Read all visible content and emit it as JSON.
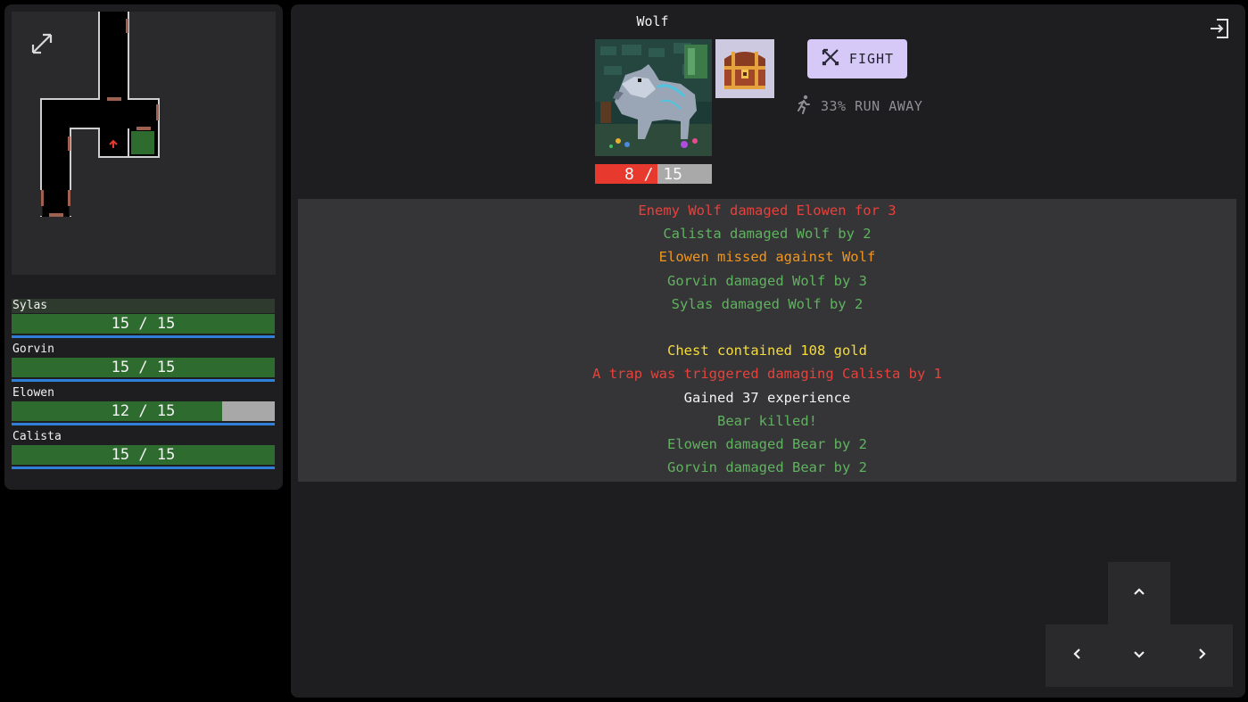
{
  "party": [
    {
      "name": "Sylas",
      "hp": 15,
      "max_hp": 15,
      "hp_text": "15 / 15"
    },
    {
      "name": "Gorvin",
      "hp": 15,
      "max_hp": 15,
      "hp_text": "15 / 15"
    },
    {
      "name": "Elowen",
      "hp": 12,
      "max_hp": 15,
      "hp_text": "12 / 15"
    },
    {
      "name": "Calista",
      "hp": 15,
      "max_hp": 15,
      "hp_text": "15 / 15"
    }
  ],
  "enemy": {
    "name": "Wolf",
    "hp": 8,
    "max_hp": 15,
    "hp_text": "8 / 15"
  },
  "actions": {
    "fight_label": "FIGHT",
    "run_label": "33% RUN AWAY"
  },
  "log": [
    {
      "text": "Enemy Wolf damaged Elowen for 3",
      "color": "#e8413a"
    },
    {
      "text": "Calista damaged Wolf by 2",
      "color": "#5fb35e"
    },
    {
      "text": "Elowen missed against Wolf",
      "color": "#f0961e"
    },
    {
      "text": "Gorvin damaged Wolf by 3",
      "color": "#5fb35e"
    },
    {
      "text": "Sylas damaged Wolf by 2",
      "color": "#5fb35e"
    },
    {
      "text": "",
      "color": "#ffffff"
    },
    {
      "text": "Chest contained 108 gold",
      "color": "#f5dc3c"
    },
    {
      "text": "A trap was triggered damaging Calista by 1",
      "color": "#e8413a"
    },
    {
      "text": "Gained 37 experience",
      "color": "#f2f2f2"
    },
    {
      "text": "Bear killed!",
      "color": "#5fb35e"
    },
    {
      "text": "Elowen damaged Bear by 2",
      "color": "#5fb35e"
    },
    {
      "text": "Gorvin damaged Bear by 2",
      "color": "#5fb35e"
    }
  ],
  "icons": {
    "expand": "expand-icon",
    "exit": "exit-icon",
    "fight": "crossed-swords-icon",
    "run": "running-person-icon",
    "player_marker": "arrow-up-icon",
    "dpad": [
      "chevron-up-icon",
      "chevron-left-icon",
      "chevron-down-icon",
      "chevron-right-icon"
    ]
  },
  "colors": {
    "hp_green": "#2e6b2f",
    "hp_missing": "#a8a8a8",
    "xp_blue": "#2f7fdb",
    "enemy_hp": "#e8392e",
    "fight_button": "#d6c8f7",
    "log_background": "#353538"
  }
}
